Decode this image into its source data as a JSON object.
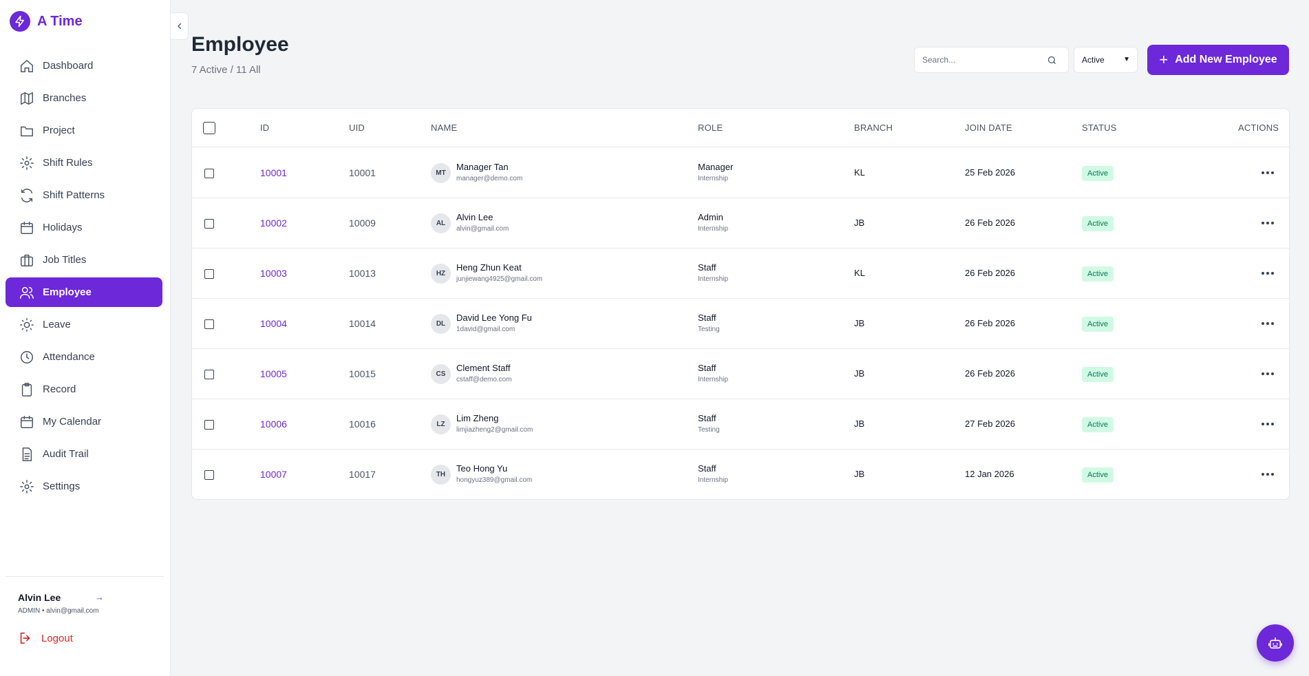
{
  "brand": {
    "name": "A Time"
  },
  "sidebar": {
    "items": [
      {
        "label": "Dashboard",
        "icon": "home-icon"
      },
      {
        "label": "Branches",
        "icon": "map-icon"
      },
      {
        "label": "Project",
        "icon": "folder-icon"
      },
      {
        "label": "Shift Rules",
        "icon": "gear-icon"
      },
      {
        "label": "Shift Patterns",
        "icon": "refresh-icon"
      },
      {
        "label": "Holidays",
        "icon": "calendar-icon"
      },
      {
        "label": "Job Titles",
        "icon": "briefcase-icon"
      },
      {
        "label": "Employee",
        "icon": "users-icon",
        "active": true
      },
      {
        "label": "Leave",
        "icon": "sun-icon"
      },
      {
        "label": "Attendance",
        "icon": "clock-icon"
      },
      {
        "label": "Record",
        "icon": "clipboard-icon"
      },
      {
        "label": "My Calendar",
        "icon": "calendar-icon"
      },
      {
        "label": "Audit Trail",
        "icon": "document-icon"
      },
      {
        "label": "Settings",
        "icon": "gear-icon"
      }
    ],
    "user": {
      "name": "Alvin Lee",
      "meta": "ADMIN • alvin@gmail.com",
      "go": "→"
    },
    "logout_label": "Logout"
  },
  "header": {
    "title": "Employee",
    "subtitle": "7 Active / 11 All",
    "search_placeholder": "Search...",
    "status_filter": "Active",
    "add_button": "Add New Employee"
  },
  "table": {
    "columns": {
      "id": "ID",
      "uid": "UID",
      "name": "NAME",
      "role": "ROLE",
      "branch": "BRANCH",
      "join_date": "JOIN DATE",
      "status": "STATUS",
      "actions": "ACTIONS"
    },
    "rows": [
      {
        "id": "10001",
        "uid": "10001",
        "initials": "MT",
        "name": "Manager Tan",
        "email": "manager@demo.com",
        "role": "Manager",
        "type": "Internship",
        "branch": "KL",
        "join_date": "25 Feb 2026",
        "status": "Active"
      },
      {
        "id": "10002",
        "uid": "10009",
        "initials": "AL",
        "name": "Alvin Lee",
        "email": "alvin@gmail.com",
        "role": "Admin",
        "type": "Internship",
        "branch": "JB",
        "join_date": "26 Feb 2026",
        "status": "Active"
      },
      {
        "id": "10003",
        "uid": "10013",
        "initials": "HZ",
        "name": "Heng Zhun Keat",
        "email": "junjiewang4925@gmail.com",
        "role": "Staff",
        "type": "Internship",
        "branch": "KL",
        "join_date": "26 Feb 2026",
        "status": "Active"
      },
      {
        "id": "10004",
        "uid": "10014",
        "initials": "DL",
        "name": "David Lee Yong Fu",
        "email": "1david@gmail.com",
        "role": "Staff",
        "type": "Testing",
        "branch": "JB",
        "join_date": "26 Feb 2026",
        "status": "Active"
      },
      {
        "id": "10005",
        "uid": "10015",
        "initials": "CS",
        "name": "Clement Staff",
        "email": "cstaff@demo.com",
        "role": "Staff",
        "type": "Internship",
        "branch": "JB",
        "join_date": "26 Feb 2026",
        "status": "Active"
      },
      {
        "id": "10006",
        "uid": "10016",
        "initials": "LZ",
        "name": "Lim Zheng",
        "email": "limjiazheng2@gmail.com",
        "role": "Staff",
        "type": "Testing",
        "branch": "JB",
        "join_date": "27 Feb 2026",
        "status": "Active"
      },
      {
        "id": "10007",
        "uid": "10017",
        "initials": "TH",
        "name": "Teo Hong Yu",
        "email": "hongyuz389@gmail.com",
        "role": "Staff",
        "type": "Internship",
        "branch": "JB",
        "join_date": "12 Jan 2026",
        "status": "Active"
      }
    ]
  },
  "colors": {
    "accent": "#6d28d9",
    "status_bg": "#d1fae5",
    "status_text": "#047857",
    "danger": "#dc2626"
  }
}
